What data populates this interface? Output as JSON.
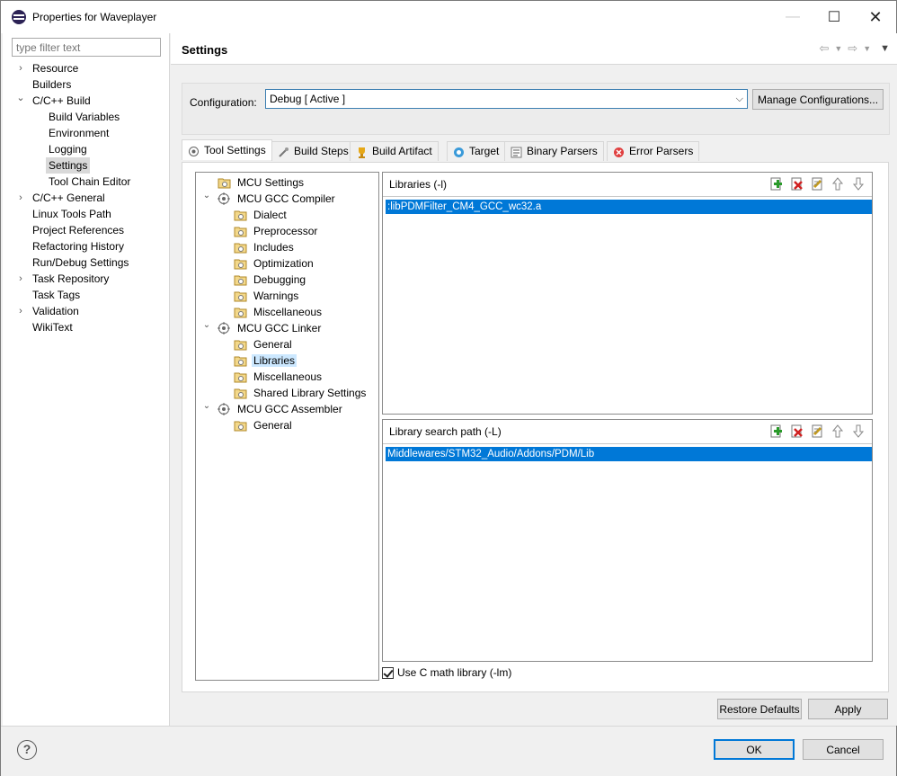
{
  "window": {
    "title": "Properties for Waveplayer",
    "icon": "eclipse-icon"
  },
  "filter": {
    "placeholder": "type filter text"
  },
  "nav": [
    {
      "label": "Resource",
      "expander": "›"
    },
    {
      "label": "Builders"
    },
    {
      "label": "C/C++ Build",
      "expander": "⌄"
    },
    {
      "label": "Build Variables"
    },
    {
      "label": "Environment"
    },
    {
      "label": "Logging"
    },
    {
      "label": "Settings",
      "selected": true
    },
    {
      "label": "Tool Chain Editor"
    },
    {
      "label": "C/C++ General",
      "expander": "›"
    },
    {
      "label": "Linux Tools Path"
    },
    {
      "label": "Project References"
    },
    {
      "label": "Refactoring History"
    },
    {
      "label": "Run/Debug Settings"
    },
    {
      "label": "Task Repository",
      "expander": "›"
    },
    {
      "label": "Task Tags"
    },
    {
      "label": "Validation",
      "expander": "›"
    },
    {
      "label": "WikiText"
    }
  ],
  "header": {
    "title": "Settings"
  },
  "config": {
    "label": "Configuration:",
    "value": "Debug  [ Active ]",
    "manage": "Manage Configurations..."
  },
  "tabs": [
    {
      "label": "Tool Settings",
      "icon": "tool-settings-icon"
    },
    {
      "label": "Build Steps",
      "icon": "build-steps-icon"
    },
    {
      "label": "Build Artifact",
      "icon": "trophy-icon"
    },
    {
      "label": "Target",
      "icon": "target-icon"
    },
    {
      "label": "Binary Parsers",
      "icon": "binary-parser-icon"
    },
    {
      "label": "Error Parsers",
      "icon": "error-icon"
    }
  ],
  "tree": [
    {
      "label": "MCU Settings"
    },
    {
      "label": "MCU GCC Compiler",
      "expander": "⌄"
    },
    {
      "label": "Dialect"
    },
    {
      "label": "Preprocessor"
    },
    {
      "label": "Includes"
    },
    {
      "label": "Optimization"
    },
    {
      "label": "Debugging"
    },
    {
      "label": "Warnings"
    },
    {
      "label": "Miscellaneous"
    },
    {
      "label": "MCU GCC Linker",
      "expander": "⌄"
    },
    {
      "label": "General"
    },
    {
      "label": "Libraries",
      "selected": true
    },
    {
      "label": "Miscellaneous"
    },
    {
      "label": "Shared Library Settings"
    },
    {
      "label": "MCU GCC Assembler",
      "expander": "⌄"
    },
    {
      "label": "General"
    }
  ],
  "libraries": {
    "title": "Libraries (-l)",
    "items": [
      ":libPDMFilter_CM4_GCC_wc32.a"
    ]
  },
  "search_path": {
    "title": "Library search path (-L)",
    "items": [
      "Middlewares/STM32_Audio/Addons/PDM/Lib"
    ]
  },
  "math": {
    "label": "Use C math library (-lm)",
    "checked": true
  },
  "buttons": {
    "restore": "Restore Defaults",
    "apply": "Apply",
    "ok": "OK",
    "cancel": "Cancel",
    "help": "?"
  },
  "colors": {
    "selection": "#0078d7",
    "tree_selection": "#cce8ff"
  }
}
